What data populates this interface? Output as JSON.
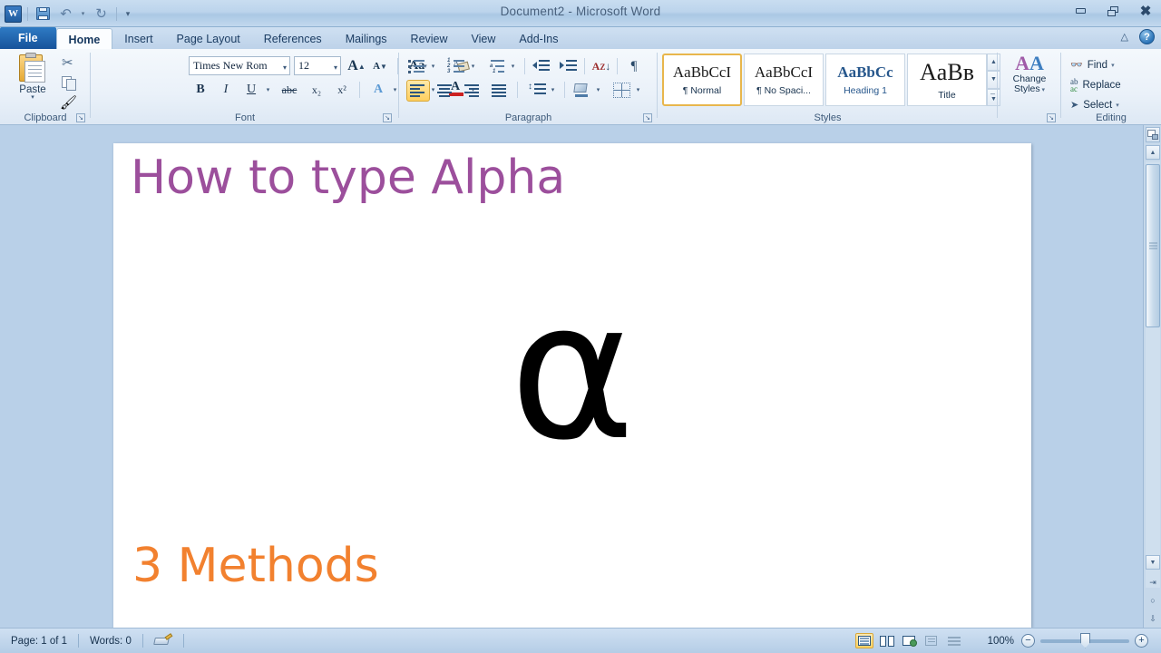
{
  "window": {
    "title": "Document2  -  Microsoft Word",
    "app_logo": "W",
    "controls": {
      "minimize": "minimize-icon",
      "restore": "restore-icon",
      "close": "✖"
    }
  },
  "quick_access": {
    "save": "save-icon",
    "undo": "↶",
    "redo": "↻",
    "customize": "▾"
  },
  "ribbon_helpers": {
    "collapse": "△",
    "help": "?"
  },
  "tabs": [
    {
      "label": "File",
      "state": "file"
    },
    {
      "label": "Home",
      "state": "active"
    },
    {
      "label": "Insert",
      "state": "normal"
    },
    {
      "label": "Page Layout",
      "state": "normal"
    },
    {
      "label": "References",
      "state": "normal"
    },
    {
      "label": "Mailings",
      "state": "normal"
    },
    {
      "label": "Review",
      "state": "normal"
    },
    {
      "label": "View",
      "state": "normal"
    },
    {
      "label": "Add-Ins",
      "state": "normal"
    }
  ],
  "ribbon": {
    "clipboard": {
      "group_label": "Clipboard",
      "paste_label": "Paste",
      "paste_caret": "▾",
      "cut": "scissors-icon",
      "copy": "copy-icon",
      "format_painter": "paintbrush-icon",
      "dialog_launcher": "↘"
    },
    "font": {
      "group_label": "Font",
      "font_name_value": "Times New Rom",
      "font_size_value": "12",
      "grow_font": "A",
      "shrink_font": "A",
      "change_case": "Aa",
      "clear_formatting": "clear-formatting-icon",
      "bold": "B",
      "italic": "I",
      "underline": "U",
      "strikethrough": "abc",
      "subscript": "x₂",
      "superscript": "x²",
      "text_effects": "A",
      "highlight": "ab",
      "font_color": "A",
      "font_color_swatch": "#cc2222",
      "highlight_swatch": "#ffe94d",
      "dialog_launcher": "↘"
    },
    "paragraph": {
      "group_label": "Paragraph",
      "bullets": "bullets-icon",
      "numbering": "numbering-icon",
      "multilevel_list": "multilevel-list-icon",
      "decrease_indent": "decrease-indent-icon",
      "increase_indent": "increase-indent-icon",
      "sort": "sort-icon",
      "show_marks": "¶",
      "align_left": "align-left-icon",
      "align_center": "align-center-icon",
      "align_right": "align-right-icon",
      "justify": "justify-icon",
      "line_spacing": "line-spacing-icon",
      "shading": "shading-icon",
      "borders": "borders-icon",
      "active_alignment": "align_left",
      "dialog_launcher": "↘"
    },
    "styles": {
      "group_label": "Styles",
      "items": [
        {
          "preview": "AaBbCcI",
          "name": "¶ Normal",
          "selected": true,
          "preview_size": "17px",
          "preview_weight": "normal",
          "preview_color": "#1a1a1a"
        },
        {
          "preview": "AaBbCcI",
          "name": "¶ No Spaci...",
          "selected": false,
          "preview_size": "17px",
          "preview_weight": "normal",
          "preview_color": "#1a1a1a"
        },
        {
          "preview": "AaBbCс",
          "name": "Heading 1",
          "selected": false,
          "preview_size": "17px",
          "preview_weight": "bold",
          "preview_color": "#2a5party"
        },
        {
          "preview": "AaBв",
          "name": "Title",
          "selected": false,
          "preview_size": "26px",
          "preview_weight": "normal",
          "preview_color": "#1a1a1a"
        }
      ],
      "scroll_up": "▲",
      "scroll_down": "▼",
      "more": "▼",
      "change_styles_label_line1": "Change",
      "change_styles_label_line2": "Styles",
      "change_styles_caret": "▾",
      "dialog_launcher": "↘"
    },
    "editing": {
      "group_label": "Editing",
      "items": [
        {
          "label": "Find",
          "icon": "binoculars-icon",
          "caret": "▾"
        },
        {
          "label": "Replace",
          "icon": "replace-icon",
          "caret": ""
        },
        {
          "label": "Select",
          "icon": "cursor-icon",
          "caret": "▾"
        }
      ]
    }
  },
  "document": {
    "title_text": "How to type Alpha",
    "title_color": "#9c4f9c",
    "symbol_text": "α",
    "symbol_color": "#000000",
    "subtitle_text": "3 Methods",
    "subtitle_color": "#f2812f"
  },
  "scrollbar": {
    "ruler_toggle": "ruler-toggle-icon",
    "scroll_up": "▲",
    "scroll_down": "▼",
    "previous_page": "⬆",
    "select_browse_object": "○",
    "next_page": "⬇"
  },
  "status_bar": {
    "page": "Page: 1 of 1",
    "words": "Words: 0",
    "proofing": "proofing-icon",
    "view_buttons": [
      {
        "name": "print-layout",
        "selected": true
      },
      {
        "name": "full-screen-reading",
        "selected": false
      },
      {
        "name": "web-layout",
        "selected": false
      },
      {
        "name": "outline",
        "selected": false
      },
      {
        "name": "draft",
        "selected": false
      }
    ],
    "zoom_level": "100%",
    "zoom_out": "−",
    "zoom_in": "+"
  }
}
